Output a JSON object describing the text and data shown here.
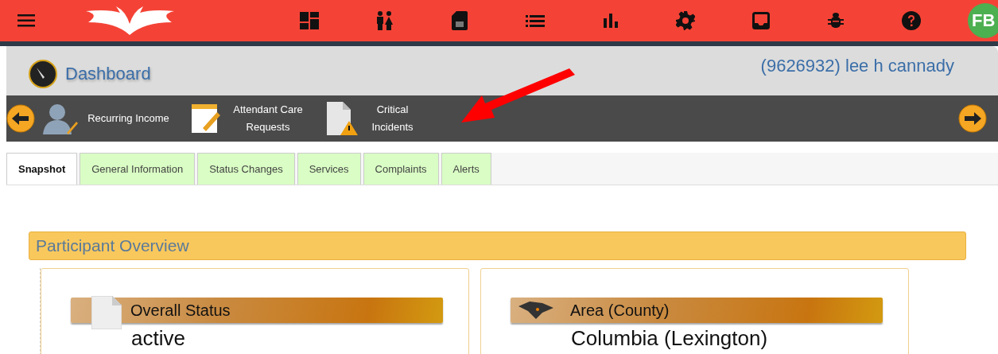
{
  "top_bar": {
    "avatar": "FB"
  },
  "header": {
    "title": "Dashboard",
    "participant": "(9626932) lee h cannady"
  },
  "shortcuts": [
    {
      "label": "Recurring Income",
      "kind": "person"
    },
    {
      "label": "Attendant Care Requests",
      "kind": "note"
    },
    {
      "label": "Critical Incidents",
      "kind": "warning"
    }
  ],
  "tabs": [
    {
      "label": "Snapshot",
      "selected": true
    },
    {
      "label": "General Information",
      "selected": false
    },
    {
      "label": "Status Changes",
      "selected": false
    },
    {
      "label": "Services",
      "selected": false
    },
    {
      "label": "Complaints",
      "selected": false
    },
    {
      "label": "Alerts",
      "selected": false
    }
  ],
  "panel": {
    "title": "Participant Overview",
    "cards": [
      {
        "heading": "Overall Status",
        "value": "active",
        "kind": "document"
      },
      {
        "heading": "Area (County)",
        "value": "Columbia (Lexington)",
        "kind": "map"
      }
    ]
  }
}
